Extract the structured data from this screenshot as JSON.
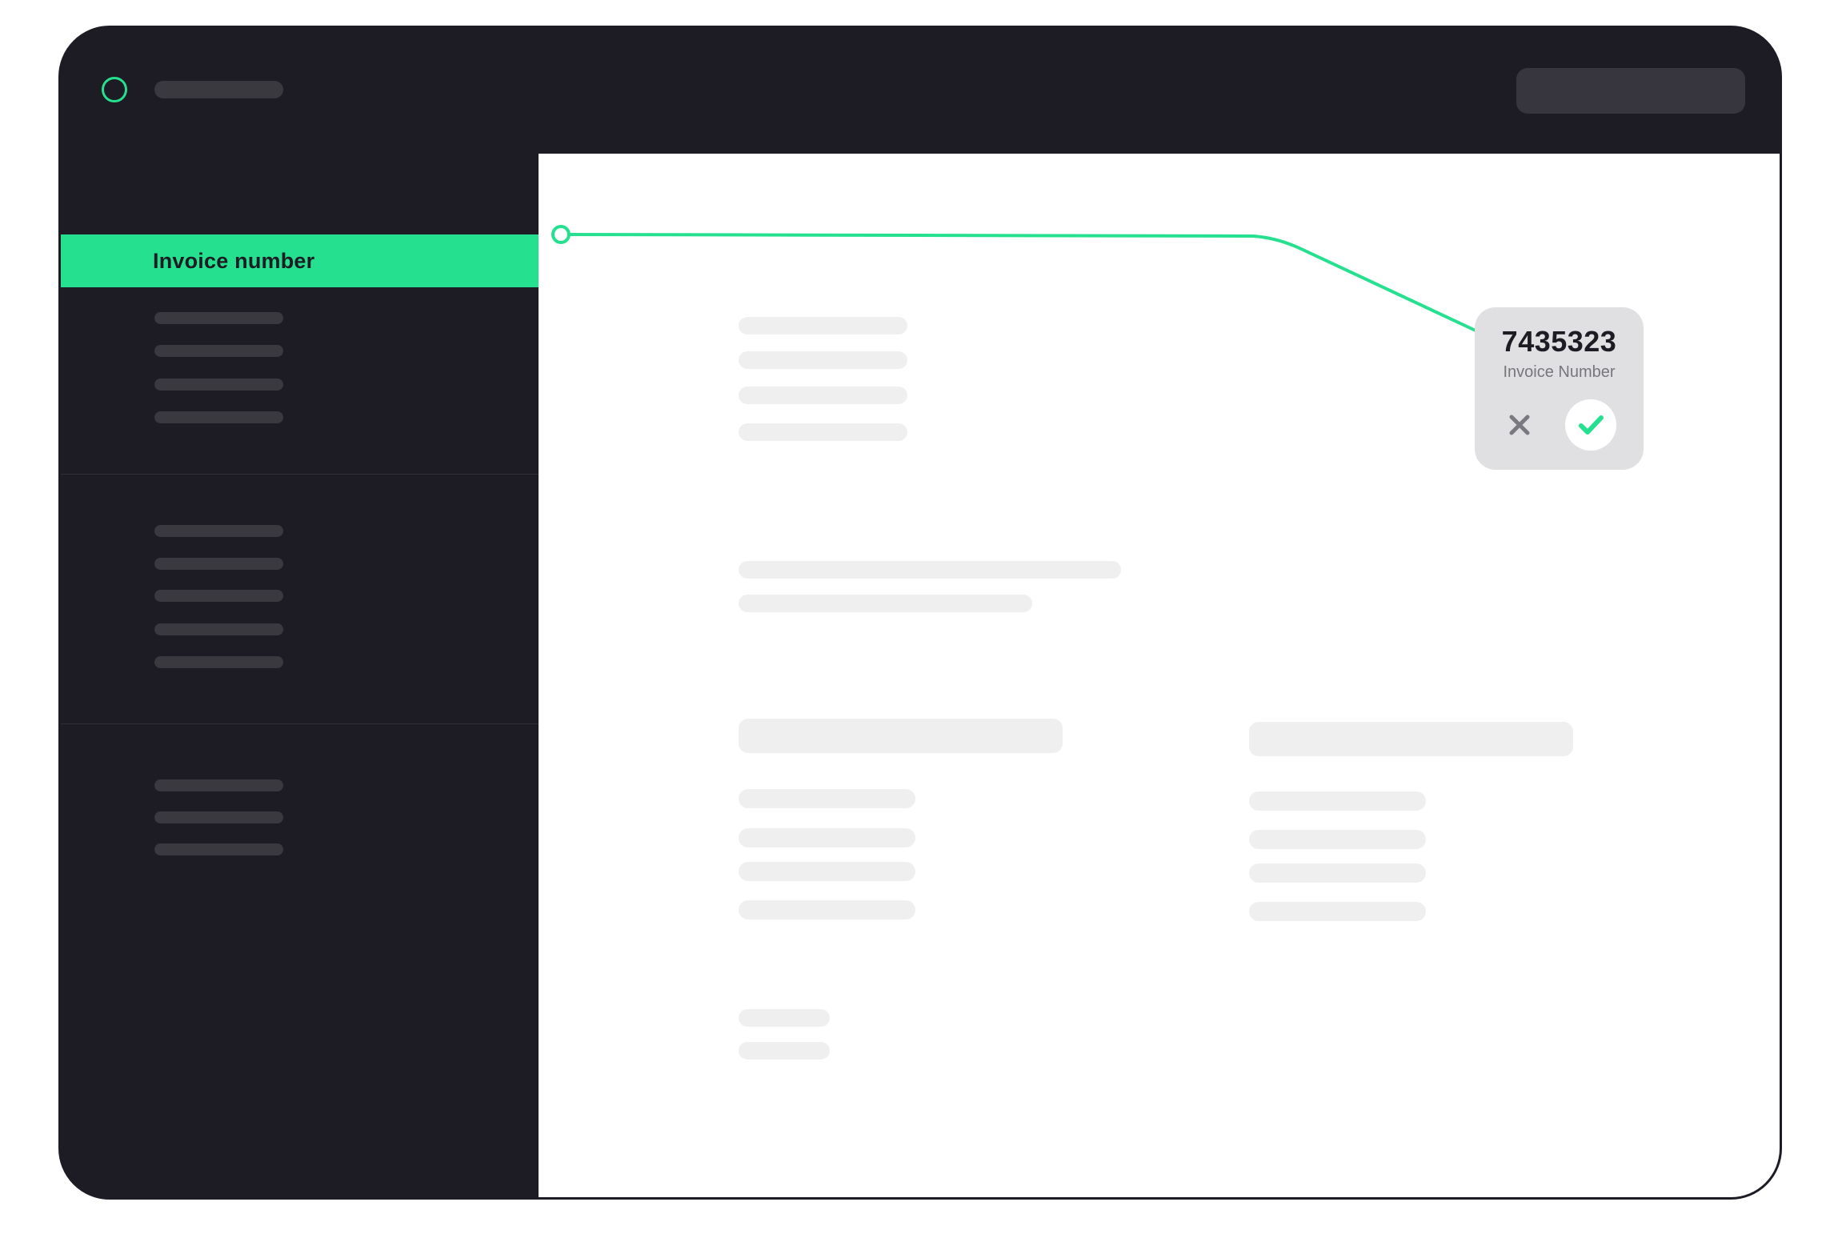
{
  "sidebar": {
    "active_item": {
      "label": "Invoice number"
    }
  },
  "extraction_popup": {
    "value": "7435323",
    "label": "Invoice Number",
    "reject_icon": "close-icon",
    "accept_icon": "check-icon"
  },
  "colors": {
    "accent": "#25e08f",
    "dark": "#1d1c24",
    "placeholder": "#efefef",
    "popup_bg": "#e0e0e2"
  }
}
